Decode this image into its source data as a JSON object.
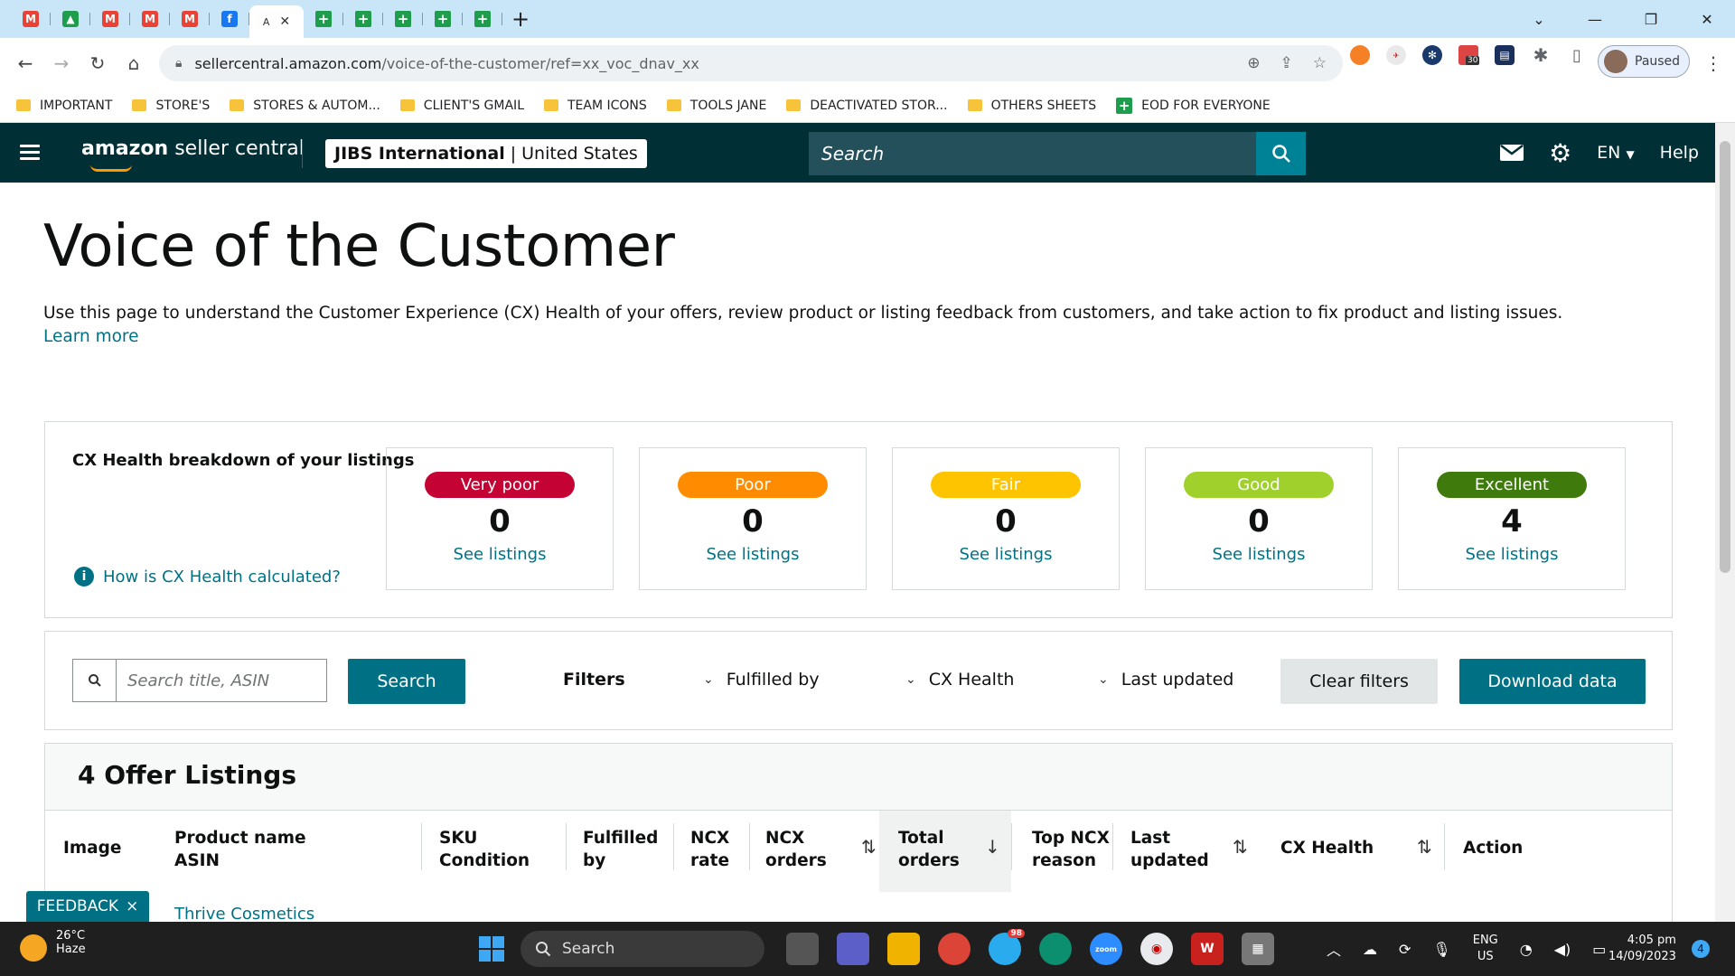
{
  "browser": {
    "tabs": [
      {
        "icon": "gmail-icon",
        "letter": "M",
        "color": "#ea4335"
      },
      {
        "icon": "drive-icon",
        "letter": "▲",
        "color": "#1e9e4d"
      },
      {
        "icon": "gmail-icon",
        "letter": "M",
        "color": "#ea4335"
      },
      {
        "icon": "gmail-icon",
        "letter": "M",
        "color": "#ea4335"
      },
      {
        "icon": "gmail-icon",
        "letter": "M",
        "color": "#ea4335"
      },
      {
        "icon": "facebook-icon",
        "letter": "f",
        "color": "#1877f2"
      }
    ],
    "active_tab_label": "A",
    "sheets_tab_count": 5,
    "url_host": "sellercentral.amazon.com",
    "url_path": "/voice-of-the-customer/ref=xx_voc_dnav_xx",
    "profile_status": "Paused",
    "extension_badge": "30"
  },
  "bookmarks": [
    {
      "label": "IMPORTANT",
      "type": "folder"
    },
    {
      "label": "STORE'S",
      "type": "folder"
    },
    {
      "label": "STORES & AUTOM...",
      "type": "folder"
    },
    {
      "label": "CLIENT'S GMAIL",
      "type": "folder"
    },
    {
      "label": "TEAM ICONS",
      "type": "folder"
    },
    {
      "label": "TOOLS JANE",
      "type": "folder"
    },
    {
      "label": "DEACTIVATED STOR...",
      "type": "folder"
    },
    {
      "label": "OTHERS SHEETS",
      "type": "folder"
    },
    {
      "label": "EOD FOR EVERYONE",
      "type": "sheet"
    }
  ],
  "header": {
    "logo_bold": "amazon",
    "logo_rest": " seller central",
    "account_name": "JIBS International",
    "account_region": "United States",
    "search_placeholder": "Search",
    "language": "EN",
    "help": "Help"
  },
  "page": {
    "title": "Voice of the Customer",
    "intro": "Use this page to understand the Customer Experience (CX) Health of your offers, review product or listing feedback from customers, and take action to fix product and listing issues.",
    "learn_more": "Learn more"
  },
  "cx_health": {
    "heading": "CX Health breakdown of your listings",
    "help_link": "How is CX Health calculated?",
    "cards": [
      {
        "label": "Very poor",
        "count": "0",
        "link": "See listings",
        "color": "#c40233"
      },
      {
        "label": "Poor",
        "count": "0",
        "link": "See listings",
        "color": "#ff8c00"
      },
      {
        "label": "Fair",
        "count": "0",
        "link": "See listings",
        "color": "#ffc400"
      },
      {
        "label": "Good",
        "count": "0",
        "link": "See listings",
        "color": "#9fd02b"
      },
      {
        "label": "Excellent",
        "count": "4",
        "link": "See listings",
        "color": "#3e7a0c"
      }
    ]
  },
  "filters": {
    "search_placeholder": "Search title, ASIN",
    "search_button": "Search",
    "label": "Filters",
    "dropdowns": [
      "Fulfilled by",
      "CX Health",
      "Last updated"
    ],
    "clear_button": "Clear filters",
    "download_button": "Download data"
  },
  "listings": {
    "title": "4 Offer Listings",
    "columns": [
      {
        "line1": "Image",
        "line2": ""
      },
      {
        "line1": "Product name",
        "line2": "ASIN"
      },
      {
        "line1": "SKU",
        "line2": "Condition"
      },
      {
        "line1": "Fulfilled",
        "line2": "by"
      },
      {
        "line1": "NCX",
        "line2": "rate"
      },
      {
        "line1": "NCX",
        "line2": "orders"
      },
      {
        "line1": "Total",
        "line2": "orders"
      },
      {
        "line1": "Top NCX",
        "line2": "reason"
      },
      {
        "line1": "Last",
        "line2": "updated"
      },
      {
        "line1": "CX Health",
        "line2": ""
      },
      {
        "line1": "Action",
        "line2": ""
      }
    ],
    "first_row_product": "Thrive Cosmetics"
  },
  "feedback": {
    "label": "FEEDBACK",
    "close": "×"
  },
  "taskbar": {
    "temperature": "26°C",
    "weather": "Haze",
    "search": "Search",
    "telegram_badge": "98",
    "lang_line1": "ENG",
    "lang_line2": "US",
    "time": "4:05 pm",
    "date": "14/09/2023",
    "notifications": "4"
  }
}
